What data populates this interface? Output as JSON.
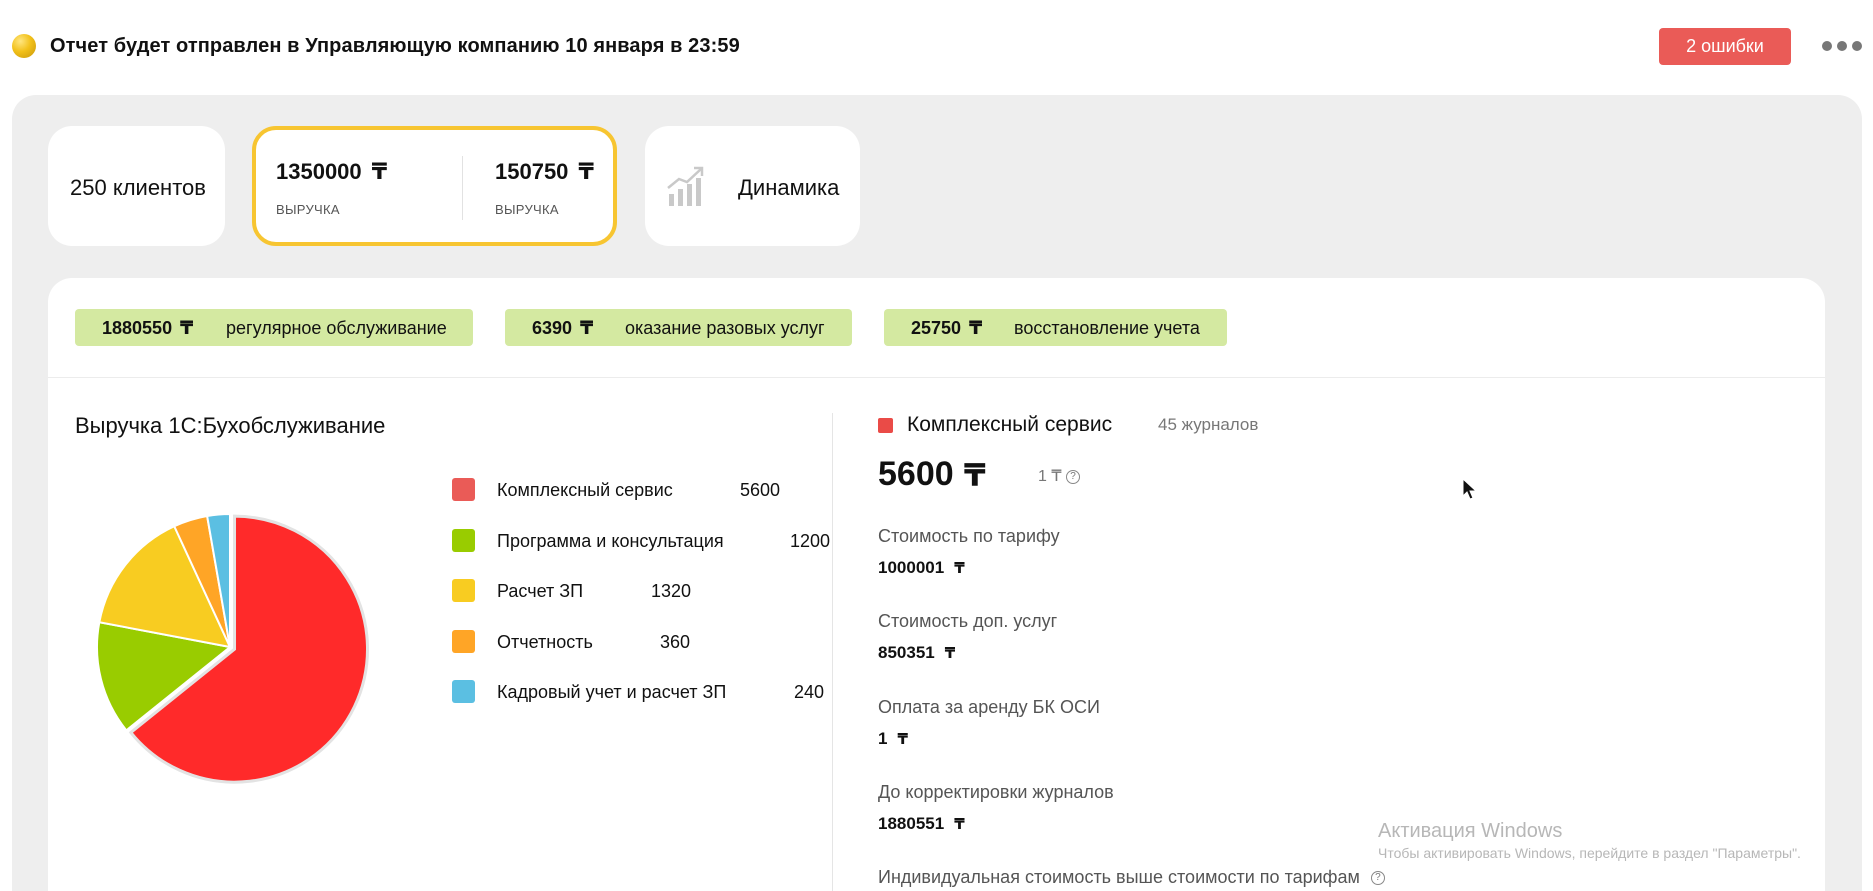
{
  "header": {
    "title": "Отчет будет отправлен в Управляющую компанию 10 января в 23:59",
    "errors_button": "2 ошибки",
    "status_color": "#f2c11a",
    "error_color": "#ea5b57"
  },
  "summary": {
    "clients": "250 клиентов",
    "revenue": [
      {
        "value": "1350000",
        "currency": "₸",
        "label": "ВЫРУЧКА"
      },
      {
        "value": "150750",
        "currency": "₸",
        "label": "ВЫРУЧКА"
      }
    ],
    "dynamics": "Динамика",
    "highlight_color": "#f7c531"
  },
  "chips": [
    {
      "amount": "1880550",
      "currency": "₸",
      "label": "регулярное обслуживание"
    },
    {
      "amount": "6390",
      "currency": "₸",
      "label": "оказание разовых услуг"
    },
    {
      "amount": "25750",
      "currency": "₸",
      "label": "восстановление учета"
    }
  ],
  "chart_panel": {
    "title": "Выручка 1С:Бухобслуживание"
  },
  "chart_data": {
    "type": "pie",
    "title": "Выручка 1С:Бухобслуживание",
    "categories": [
      "Комплексный сервис",
      "Программа и консультация",
      "Расчет ЗП",
      "Отчетность",
      "Кадровый учет и расчет ЗП"
    ],
    "values": [
      5600,
      1200,
      1320,
      360,
      240
    ],
    "colors": [
      "#ff2a2a",
      "#99cc00",
      "#f8cc21",
      "#ffa526",
      "#5bbfe2"
    ],
    "legend_colors": [
      "#ea5b57",
      "#99cc00",
      "#f8cc21",
      "#ffa526",
      "#5bbfe2"
    ],
    "legend": "right",
    "exploded_index": 0
  },
  "detail": {
    "name": "Комплексный сервис",
    "count": "45 журналов",
    "total": "5600",
    "currency": "₸",
    "small": "1 ₸",
    "help_icon": "?",
    "fields": [
      {
        "label": "Стоимость по тарифу",
        "value": "1000001",
        "currency": "₸"
      },
      {
        "label": "Стоимость доп. услуг",
        "value": "850351",
        "currency": "₸"
      },
      {
        "label": "Оплата за аренду БК ОСИ",
        "value": "1",
        "currency": "₸"
      },
      {
        "label": "До корректировки журналов",
        "value": "1880551",
        "currency": "₸"
      }
    ],
    "note": "Индивидуальная стоимость выше стоимости по тарифам"
  },
  "watermark": {
    "title": "Активация Windows",
    "subtitle": "Чтобы активировать Windows, перейдите в раздел \"Параметры\"."
  }
}
